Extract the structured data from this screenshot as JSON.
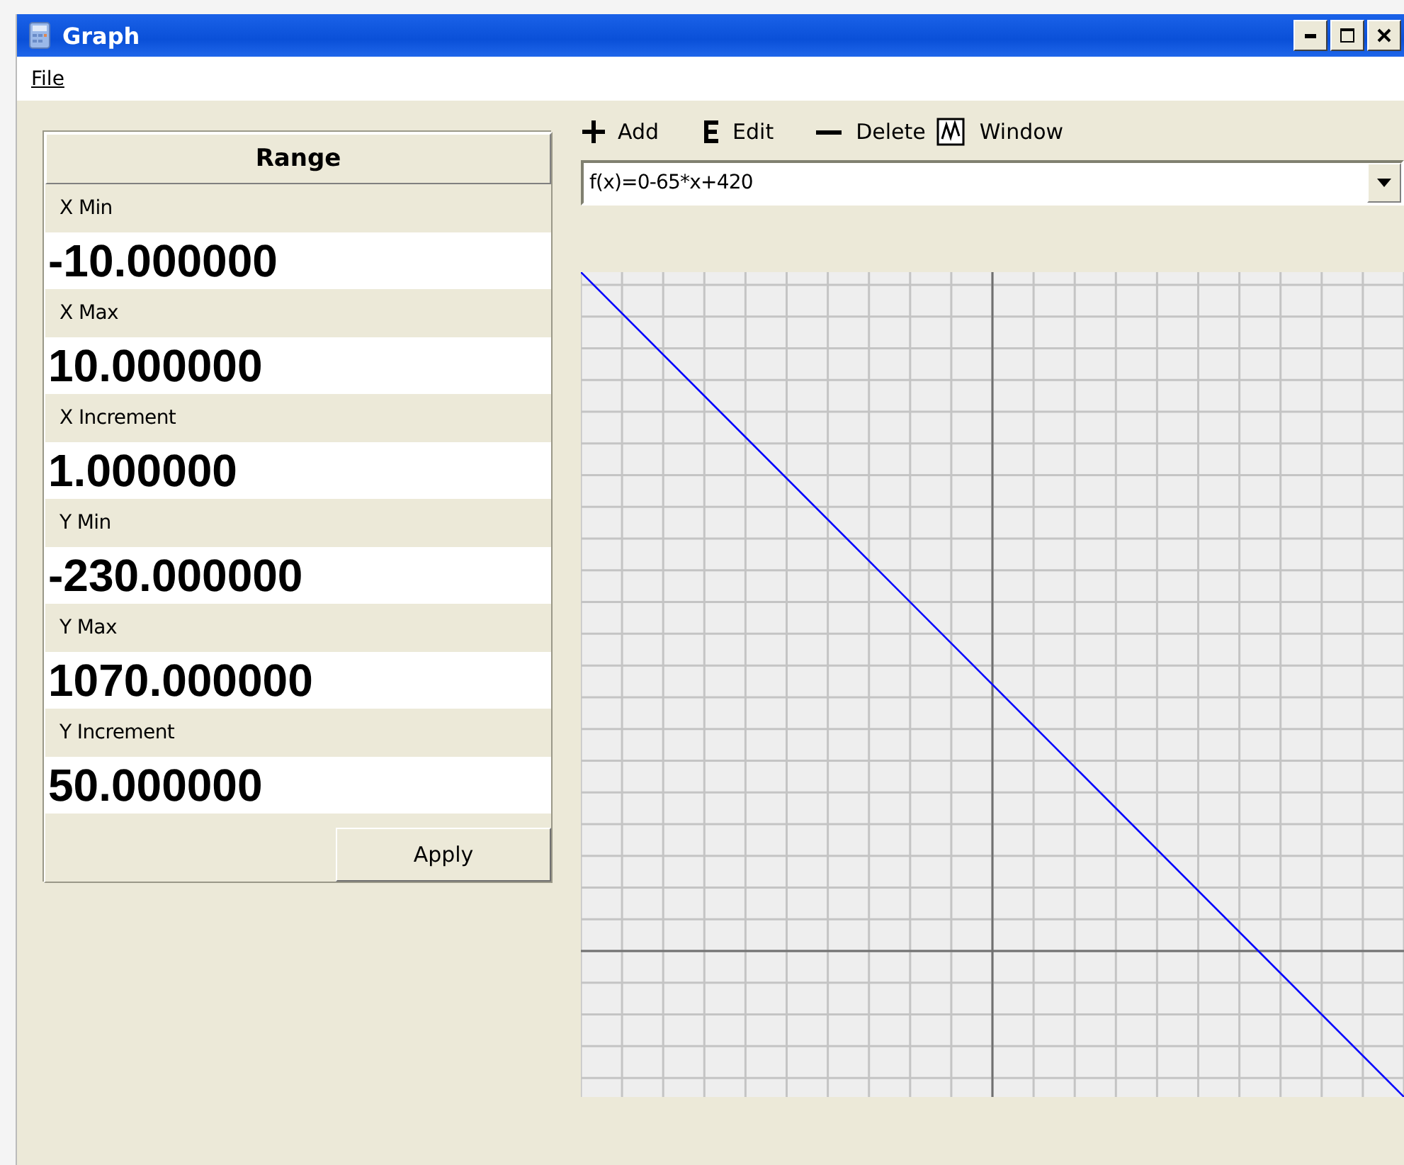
{
  "window": {
    "title": "Graph"
  },
  "menu": [
    "File"
  ],
  "range": {
    "title": "Range",
    "fields": [
      {
        "label": "X Min",
        "value": "-10.000000"
      },
      {
        "label": "X Max",
        "value": "10.000000"
      },
      {
        "label": "X Increment",
        "value": "1.000000"
      },
      {
        "label": "Y Min",
        "value": "-230.000000"
      },
      {
        "label": "Y Max",
        "value": "1070.000000"
      },
      {
        "label": "Y Increment",
        "value": "50.000000"
      }
    ],
    "apply": "Apply"
  },
  "toolbar": [
    {
      "kind": "add",
      "label": "Add"
    },
    {
      "kind": "edit",
      "label": "Edit"
    },
    {
      "kind": "delete",
      "label": "Delete"
    },
    {
      "kind": "window",
      "label": "Window"
    }
  ],
  "function_combo": {
    "value": "f(x)=0-65*x+420"
  }
}
